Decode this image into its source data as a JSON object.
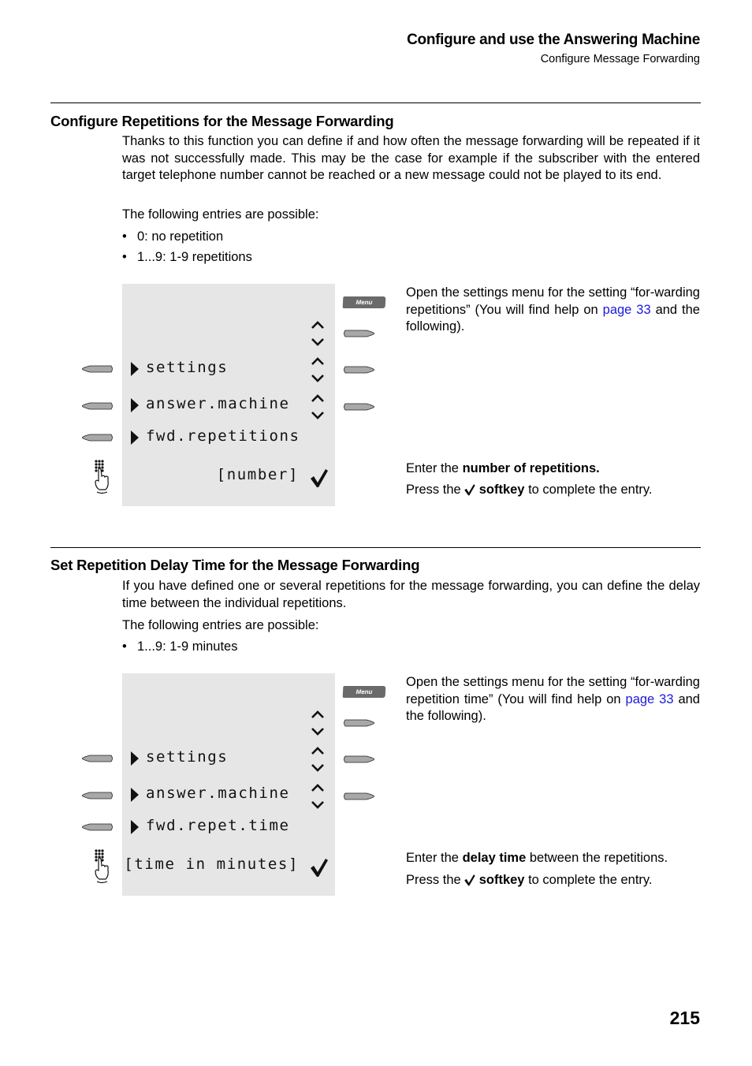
{
  "header": {
    "title": "Configure and use the Answering Machine",
    "subtitle": "Configure Message Forwarding"
  },
  "sections": [
    {
      "title": "Configure Repetitions for the Message Forwarding",
      "intro": "Thanks to this function you can define if and how often the message forwarding will be repeated if it was not successfully made. This may be the case for example if the subscriber with the entered target telephone number cannot be reached or a new message could not be played to its end.",
      "entries_label": "The following entries are possible:",
      "bullets": [
        "0: no repetition",
        "1...9: 1-9 repetitions"
      ],
      "display": {
        "menu_key": "Menu",
        "lines": [
          "settings",
          "answer.machine",
          "fwd.repetitions"
        ],
        "input": "[number]"
      },
      "step1": {
        "text_before": "Open the settings menu for the setting “for-warding repetitions” (You will find help on",
        "link": "page 33",
        "text_after": "and the following)."
      },
      "step2": {
        "prefix": "Enter the",
        "bold": "number of repetitions.",
        "suffix": ""
      },
      "step3": {
        "prefix": "Press the",
        "bold": "softkey",
        "suffix": "to complete the entry."
      }
    },
    {
      "title": "Set Repetition Delay Time for the Message Forwarding",
      "intro": "If you have defined one or several repetitions for the message forwarding, you can define the delay time between the individual repetitions.",
      "entries_label": "The following entries are possible:",
      "bullets": [
        "1...9: 1-9 minutes"
      ],
      "display": {
        "menu_key": "Menu",
        "lines": [
          "settings",
          "answer.machine",
          "fwd.repet.time"
        ],
        "input": "[time in minutes]"
      },
      "step1": {
        "text_before": "Open the settings menu for the setting “for-warding repetition time” (You will find help on",
        "link": "page 33",
        "text_after": "and the following)."
      },
      "step2": {
        "prefix": "Enter the",
        "bold": "delay time",
        "suffix": "between the repetitions."
      },
      "step3": {
        "prefix": "Press the",
        "bold": "softkey",
        "suffix": "to complete the entry."
      }
    }
  ],
  "page_number": "215",
  "colors": {
    "link": "#1a1adb",
    "display_bg": "#e6e6e6",
    "softkey": "#a8a8a8",
    "menu_key": "#6a6a6a"
  }
}
